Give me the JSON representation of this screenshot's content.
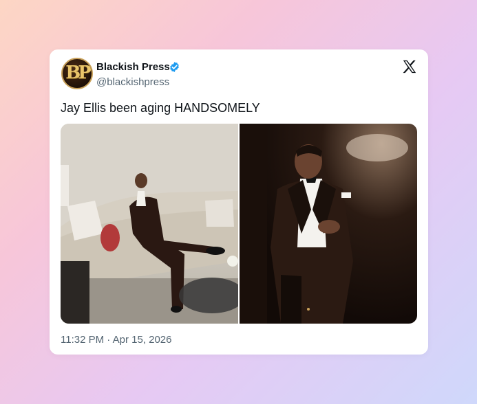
{
  "tweet": {
    "author_name": "Blackish Press",
    "author_handle": "@blackishpress",
    "avatar_monogram": "BP",
    "verified": true,
    "text": "Jay Ellis been aging HANDSOMELY",
    "timestamp": "11:32 PM · Apr 15, 2026",
    "media_count": 2
  },
  "icons": {
    "verified": "verified-badge-icon",
    "brand": "x-logo-icon"
  },
  "colors": {
    "verified_blue": "#1d9bf0",
    "text_primary": "#0f1419",
    "text_secondary": "#536471",
    "card_bg": "#ffffff"
  }
}
